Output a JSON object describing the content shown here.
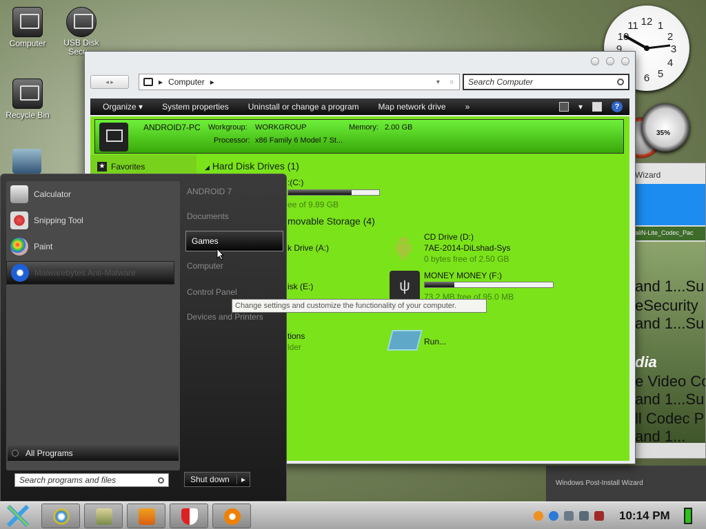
{
  "desktop": {
    "icons": [
      {
        "label": "Computer"
      },
      {
        "label": "USB Disk\nSecu..."
      },
      {
        "label": "Recycle Bin"
      }
    ]
  },
  "explorer": {
    "address": {
      "location": "Computer"
    },
    "search": {
      "placeholder": "Search Computer"
    },
    "toolbar": {
      "organize": "Organize ▾",
      "system_properties": "System properties",
      "uninstall": "Uninstall or change a program",
      "map_drive": "Map network drive",
      "more": "»"
    },
    "info": {
      "pc_name": "ANDROID7-PC",
      "workgroup_label": "Workgroup:",
      "workgroup": "WORKGROUP",
      "memory_label": "Memory:",
      "memory": "2.00 GB",
      "processor_label": "Processor:",
      "processor": "x86 Family 6 Model 7 St..."
    },
    "nav": {
      "favorites": "Favorites"
    },
    "hdd_section": "Hard Disk Drives (1)",
    "hdd": {
      "name_partial": ":(C:)",
      "free_partial": "ee of 9.89 GB",
      "used_fraction": 0.7
    },
    "removable_section": "movable Storage (4)",
    "drives": [
      {
        "name_partial": "k Drive (A:)"
      },
      {
        "name_partial": "isk (E:)"
      }
    ],
    "cd": {
      "title": "CD Drive (D:)",
      "label": "7AE-2014-DiLshad-Sys",
      "free": "0 bytes free of 2.50 GB"
    },
    "usb": {
      "title": "MONEY MONEY (F:)",
      "free": "73.2 MB free of 95.0 MB",
      "used_fraction": 0.23
    },
    "other_partial_1": "tions",
    "other_partial_2": "lder",
    "run": "Run..."
  },
  "start_menu": {
    "programs": [
      {
        "label": "Calculator"
      },
      {
        "label": "Snipping Tool"
      },
      {
        "label": "Paint"
      },
      {
        "label": "Malwarebytes Anti-Malware"
      }
    ],
    "right": {
      "user": "ANDROID 7",
      "documents": "Documents",
      "games": "Games",
      "computer": "Computer",
      "control_panel": "Control Panel",
      "devices": "Devices and Printers"
    },
    "all_programs": "All Programs",
    "search_placeholder": "Search programs and files",
    "shutdown": "Shut down",
    "tooltip": "Change settings and customize the functionality of your computer."
  },
  "background_window": {
    "title": "Wizard",
    "codec_label": "aliN-Lite_Codec_Pac",
    "lines": [
      "and 1...Su",
      "eSecurity",
      "and 1...Su",
      "dia",
      "e Video Co",
      "and 1...Su",
      "ll Codec P",
      "and 1..."
    ]
  },
  "post_install": "Windows Post-Install Wizard",
  "taskbar": {
    "time": "10:14 PM"
  },
  "gadgets": {
    "cpu_percent": "35%"
  },
  "colors": {
    "accent_green": "#7be31a",
    "taskbar": "#b8b8b8"
  }
}
